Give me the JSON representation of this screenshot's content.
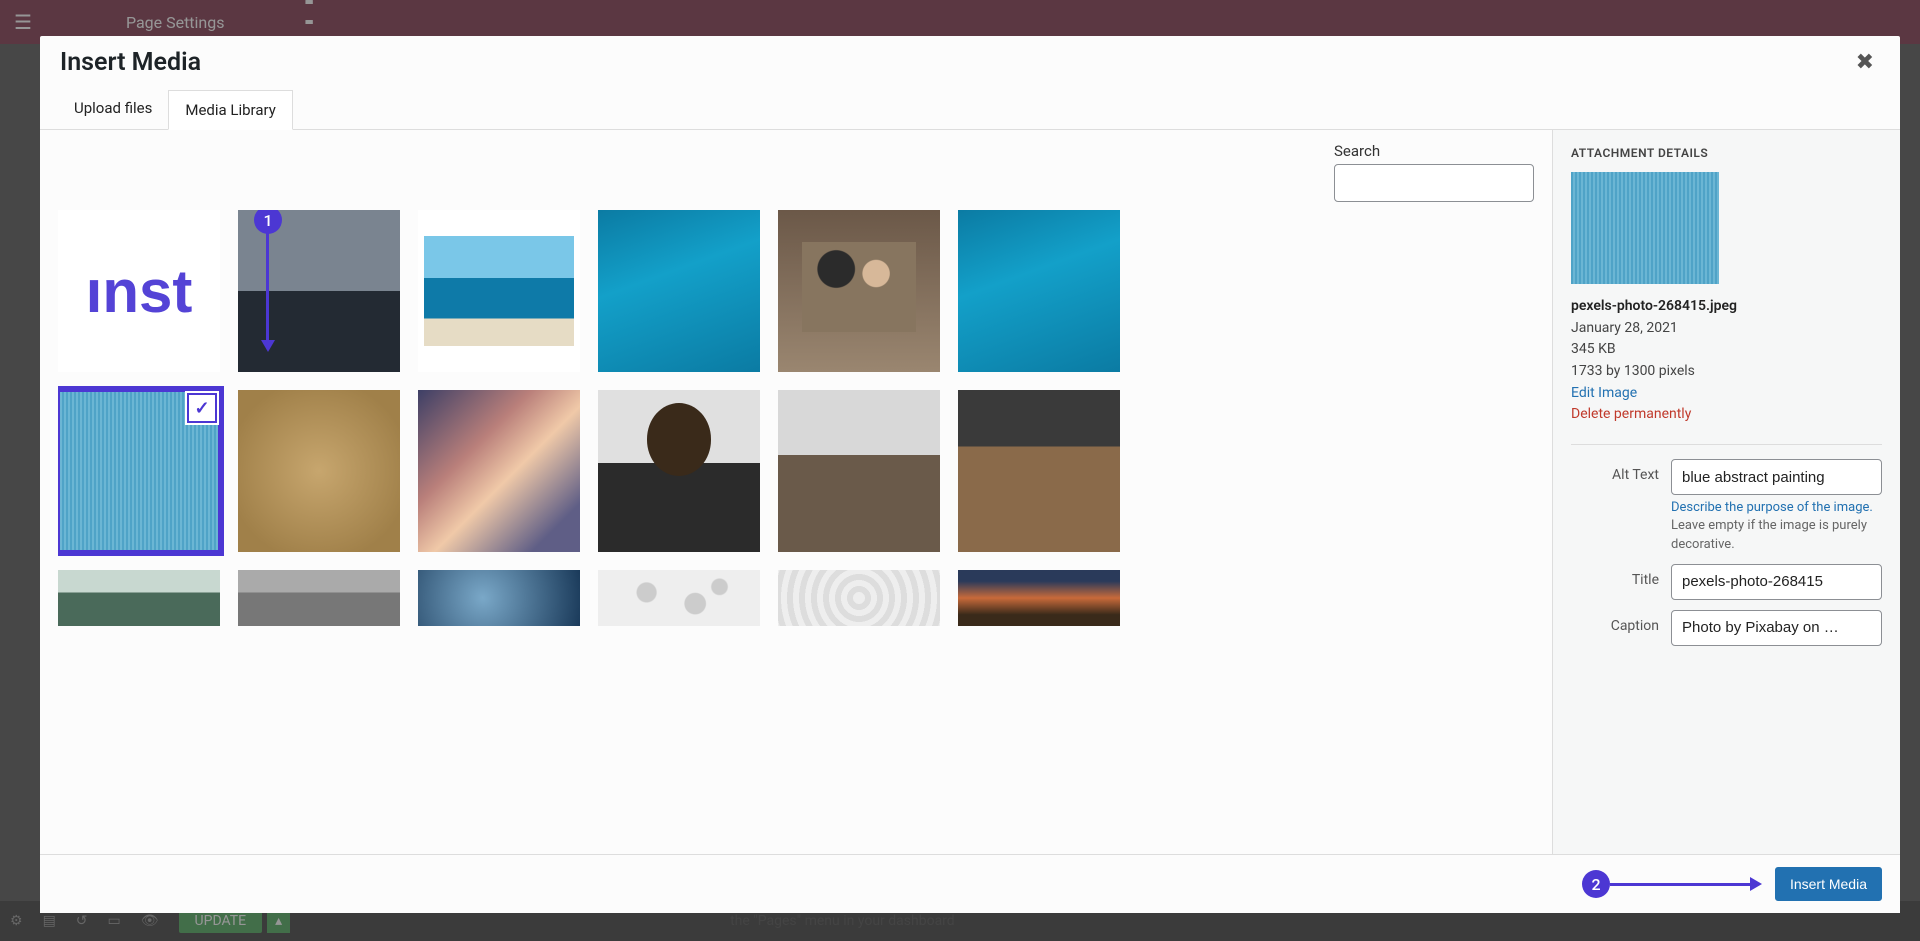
{
  "bg": {
    "page_settings": "Page Settings",
    "update": "UPDATE",
    "bottom_text": "the \"Pages\" menu in your dashboard"
  },
  "modal": {
    "title": "Insert Media",
    "tabs": {
      "upload": "Upload files",
      "library": "Media Library"
    },
    "search_label": "Search",
    "insert_btn": "Insert Media"
  },
  "details": {
    "heading": "ATTACHMENT DETAILS",
    "filename": "pexels-photo-268415.jpeg",
    "date": "January 28, 2021",
    "size": "345 KB",
    "dimensions": "1733 by 1300 pixels",
    "edit_link": "Edit Image",
    "delete_link": "Delete permanently",
    "alt_label": "Alt Text",
    "alt_value": "blue abstract painting",
    "alt_hint_link": "Describe the purpose of the image.",
    "alt_hint_rest": " Leave empty if the image is purely decorative.",
    "title_label": "Title",
    "title_value": "pexels-photo-268415",
    "caption_label": "Caption",
    "caption_value": "Photo by Pixabay on …"
  },
  "annotations": {
    "one": "1",
    "two": "2"
  }
}
